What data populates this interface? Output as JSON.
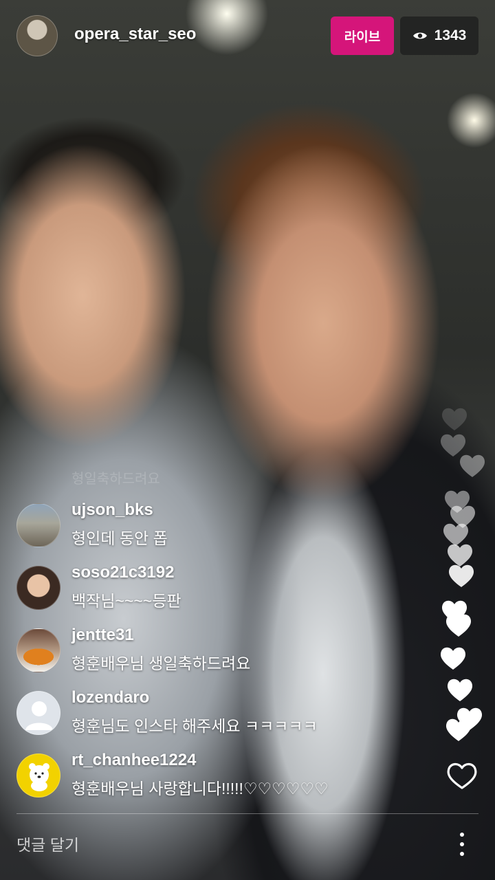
{
  "header": {
    "host_username": "opera_star_seo",
    "live_label": "라이브",
    "viewer_count": "1343"
  },
  "faded_comment": "형일축하드려요",
  "comments": [
    {
      "username": "ujson_bks",
      "text": "형인데 동안 폽"
    },
    {
      "username": "soso21c3192",
      "text": "백작님~~~~등판"
    },
    {
      "username": "jentte31",
      "text": "형훈배우님 생일축하드려요"
    },
    {
      "username": "lozendaro",
      "text": "형훈님도 인스타 해주세요 ㅋㅋㅋㅋㅋ"
    },
    {
      "username": "rt_chanhee1224",
      "text": "형훈배우님 사랑합니다!!!!!♡♡♡♡♡♡"
    }
  ],
  "footer": {
    "comment_placeholder": "댓글 달기"
  },
  "colors": {
    "live_badge": "#d5157a",
    "viewer_badge_bg": "rgba(30,30,30,0.78)"
  },
  "icons": [
    "eye-icon",
    "heart-icon",
    "more-vertical-icon"
  ]
}
